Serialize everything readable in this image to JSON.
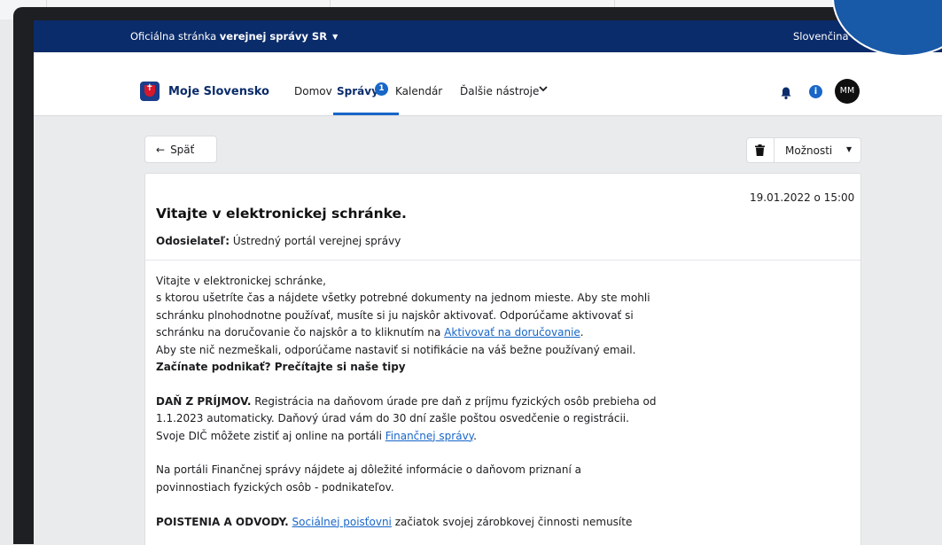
{
  "gov_bar": {
    "prefix": "Oficiálna stránka ",
    "bold": "verejnej správy SR",
    "language": "Slovenčina"
  },
  "header": {
    "brand": "Moje Slovensko",
    "nav": {
      "home": "Domov",
      "spravy": "Správy",
      "spravy_badge": "1",
      "kalendar": "Kalendár",
      "tools": "Ďalšie nástroje"
    },
    "avatar_initials": "MM",
    "icons": [
      "bell-icon",
      "info-icon"
    ]
  },
  "toolbar": {
    "back_label": "Späť",
    "options_label": "Možnosti"
  },
  "message": {
    "date": "19.01.2022 o 15:00",
    "title": "Vitajte v elektronickej schránke.",
    "sender_label": "Odosielateľ:",
    "sender_value": " Ústredný portál verejnej správy",
    "p1_l1": "Vitajte v elektronickej schránke,",
    "p1_l2": "s ktorou ušetríte čas a nájdete všetky potrebné dokumenty na jednom mieste. Aby ste mohli",
    "p1_l3": "schránku plnohodnotne používať, musíte si ju najskôr aktivovať. Odporúčame aktivovať si",
    "p1_l4_pre": "schránku na doručovanie čo najskôr a to kliknutím na ",
    "p1_l4_link": "Aktivovať na doručovanie",
    "p1_l4_post": ".",
    "p1_l5": "Aby ste nič nezmeškali, odporúčame nastaviť si notifikácie na váš bežne používaný email.",
    "p1_l6": "Začínate podnikať? Prečítajte si naše tipy",
    "p2_bold": "DAŇ Z PRÍJMOV.",
    "p2_l1_rest": " Registrácia na daňovom úrade pre daň z príjmu fyzických osôb prebieha od",
    "p2_l2": "1.1.2023 automaticky. Daňový úrad vám do 30 dní zašle poštou osvedčenie o registrácii.",
    "p2_l3_pre": "Svoje DIČ môžete zistiť aj online na portáli ",
    "p2_l3_link": "Finančnej správy",
    "p2_l3_post": ".",
    "p3_l1": "Na portáli Finančnej správy nájdete aj dôležité informácie o daňovom priznaní a",
    "p3_l2": "povinnostiach fyzických osôb - podnikateľov.",
    "p4_bold": "POISTENIA A ODVODY.",
    "p4_space": " ",
    "p4_link": "Sociálnej poisťovni",
    "p4_rest": " začiatok svojej zárobkovej činnosti nemusíte"
  },
  "colors": {
    "gov_bar": "#0b2c6b",
    "accent": "#1766c8",
    "brand_red": "#d7182a"
  }
}
